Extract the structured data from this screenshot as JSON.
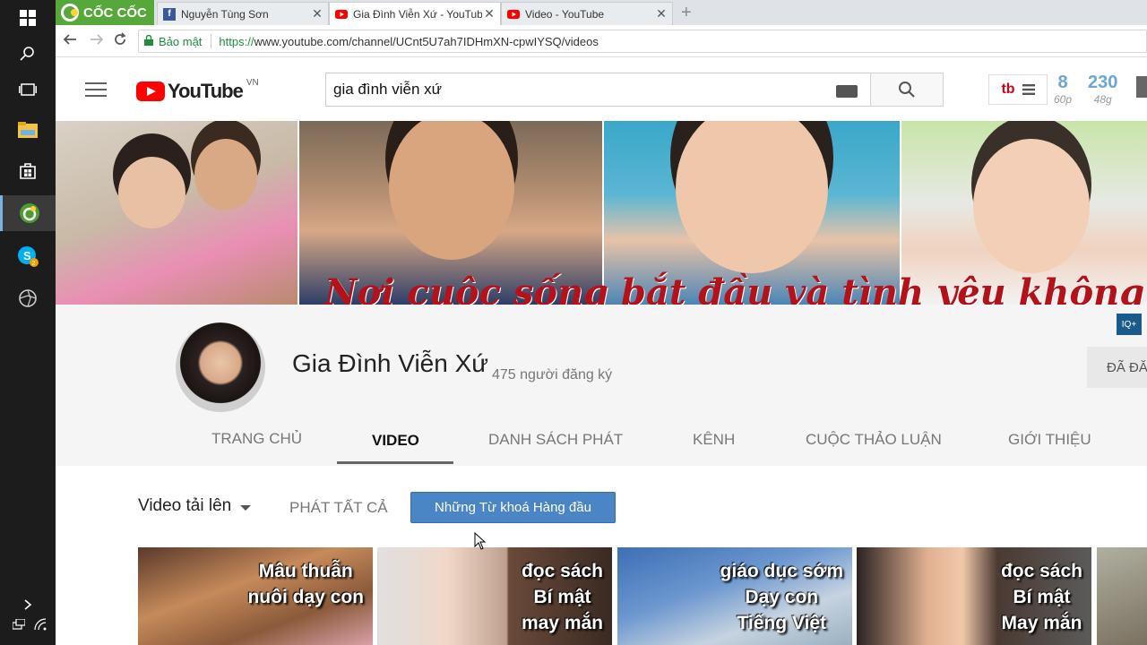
{
  "browser": {
    "brand": "CỐC CỐC",
    "tabs": [
      {
        "label": "Nguyễn Tùng Sơn",
        "favicon": "facebook-icon"
      },
      {
        "label": "Gia Đình Viễn Xứ - YouTube",
        "favicon": "youtube-icon",
        "active": true
      },
      {
        "label": "Video - YouTube",
        "favicon": "youtube-icon"
      }
    ],
    "security_label": "Bảo mật",
    "url_scheme": "https://",
    "url_rest": "www.youtube.com/channel/UCnt5U7ah7IDHmXN-cpwIYSQ/videos"
  },
  "youtube": {
    "logo_text": "YouTube",
    "country": "VN",
    "search_query": "gia đình viễn xứ",
    "stats": [
      {
        "value": "8",
        "sub": "60p"
      },
      {
        "value": "230",
        "sub": "48g"
      }
    ],
    "ext_logo": "tb"
  },
  "banner": {
    "tagline": "Nơi cuộc sống bắt đầu và tình yêu không bao giờ kết thúc"
  },
  "channel": {
    "name": "Gia Đình Viễn Xứ",
    "subscribers": "475 người đăng ký",
    "subscribe_label": "ĐÃ ĐĂNG KÝ",
    "iq_badge": "IQ+",
    "tabs": [
      "TRANG CHỦ",
      "VIDEO",
      "DANH SÁCH PHÁT",
      "KÊNH",
      "CUỘC THẢO LUẬN",
      "GIỚI THIỆU"
    ],
    "active_tab": "VIDEO"
  },
  "content": {
    "uploads_label": "Video tải lên",
    "play_all": "PHÁT TẤT CẢ",
    "keywords_button": "Những Từ khoá Hàng đầu",
    "videos": [
      {
        "caption": [
          "Mâu thuẫn",
          "nuôi dạy con"
        ]
      },
      {
        "caption": [
          "đọc sách",
          "Bí mật",
          "may mắn"
        ]
      },
      {
        "caption": [
          "giáo dục sớm",
          "Dạy con",
          "Tiếng Việt"
        ]
      },
      {
        "caption": [
          "đọc sách",
          "Bí mật",
          "May mắn"
        ]
      }
    ]
  }
}
